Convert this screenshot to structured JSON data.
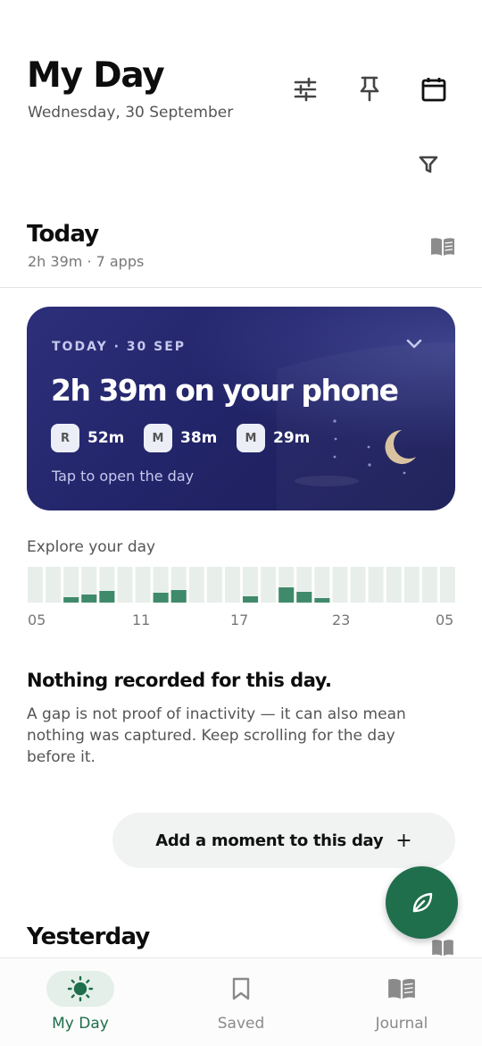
{
  "header": {
    "title": "My Day",
    "date": "Wednesday, 30 September",
    "icons": [
      "sliders-icon",
      "pin-icon",
      "calendar-icon",
      "filter-icon"
    ]
  },
  "today": {
    "title": "Today",
    "summary": "2h 39m · 7 apps",
    "icon": "book-icon"
  },
  "card": {
    "date_label": "TODAY · 30 SEP",
    "headline": "2h 39m on your phone",
    "chips": [
      {
        "badge": "R",
        "value": "52m"
      },
      {
        "badge": "M",
        "value": "38m"
      },
      {
        "badge": "M",
        "value": "29m"
      }
    ],
    "tap_hint": "Tap to open the day",
    "colors": {
      "bg": "#23256a",
      "moon": "#d9c2a0"
    }
  },
  "explore": {
    "label": "Explore your day",
    "hour_ticks": [
      "05",
      "11",
      "17",
      "23",
      "05"
    ],
    "hourly_activity": [
      0,
      0,
      0.3,
      0.45,
      0.65,
      0,
      0,
      0.55,
      0.7,
      0,
      0,
      0,
      0.35,
      0,
      0.85,
      0.6,
      0.25,
      0,
      0,
      0,
      0,
      0,
      0,
      0
    ],
    "colors": {
      "empty": "#e8efeb",
      "filled": "#3f8a6b"
    }
  },
  "empty_state": {
    "heading": "Nothing recorded for this day.",
    "body": "A gap is not proof of inactivity — it can also mean nothing was captured. Keep scrolling for the day before it."
  },
  "add_moment": {
    "label": "Add a moment to this day",
    "plus": "+"
  },
  "fab": {
    "icon": "leaf-icon",
    "color": "#1f6e4c"
  },
  "yesterday": {
    "title": "Yesterday",
    "icon": "book-icon"
  },
  "nav": {
    "items": [
      {
        "label": "My Day",
        "icon": "sun-icon",
        "active": true
      },
      {
        "label": "Saved",
        "icon": "bookmark-icon",
        "active": false
      },
      {
        "label": "Journal",
        "icon": "book-icon",
        "active": false
      }
    ],
    "active_color": "#1f6e4c",
    "active_bg": "#e3efe8",
    "inactive_color": "#8a8a8a"
  }
}
